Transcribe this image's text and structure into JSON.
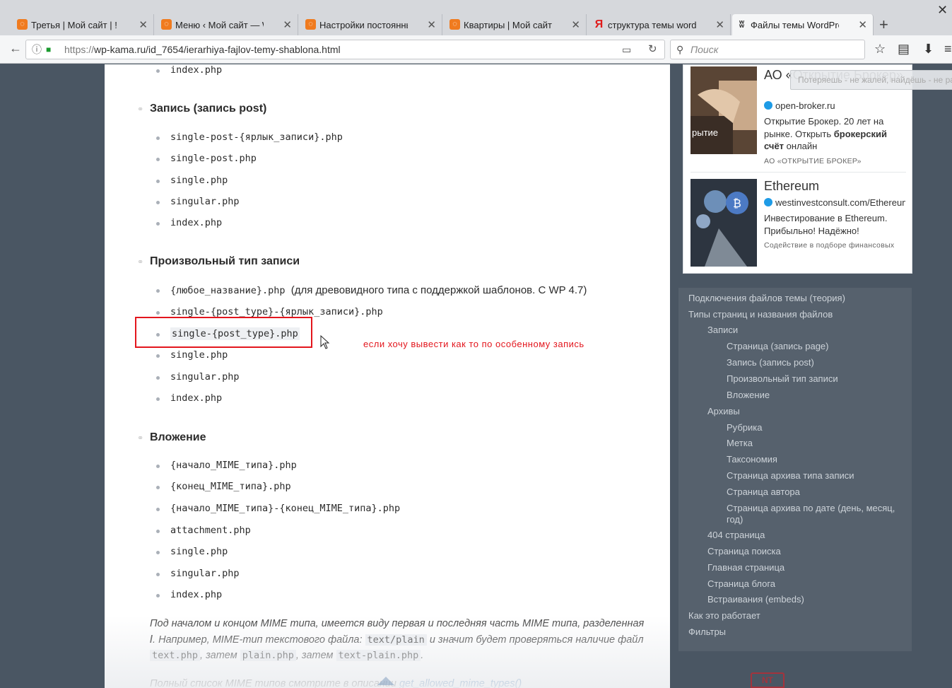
{
  "browser": {
    "tabs": [
      {
        "title": "Третья | Мой сайт | !",
        "icon": "orange-square-icon"
      },
      {
        "title": "Меню ‹ Мой сайт — WordPress",
        "icon": "orange-square-icon"
      },
      {
        "title": "Настройки постоянных ссылок",
        "icon": "orange-square-icon"
      },
      {
        "title": "Квартиры | Мой сайт | !",
        "icon": "orange-square-icon"
      },
      {
        "title": "структура темы wordpress",
        "icon": "yandex-icon"
      },
      {
        "title": "Файлы темы WordPress (шаблона)",
        "icon": "wordpress-icon"
      }
    ],
    "url_protocol": "https://",
    "url_rest": "wp-kama.ru/id_7654/ierarhiya-fajlov-temy-shablona.html",
    "search_placeholder": "Поиск"
  },
  "article": {
    "top_item": "index.php",
    "sections": [
      {
        "heading": "Запись (запись post)",
        "items": [
          "single-post-{ярлык_записи}.php",
          "single-post.php",
          "single.php",
          "singular.php",
          "index.php"
        ]
      },
      {
        "heading": "Произвольный тип записи",
        "items_first_code": "{любое_название}.php",
        "items_first_note": "(для древовидного типа с поддержкой шаблонов. С WP 4.7)",
        "items": [
          "single-{post_type}-{ярлык_записи}.php",
          "single-{post_type}.php",
          "single.php",
          "singular.php",
          "index.php"
        ]
      },
      {
        "heading": "Вложение",
        "items": [
          "{начало_MIME_типа}.php",
          "{конец_MIME_типа}.php",
          "{начало_MIME_типа}-{конец_MIME_типа}.php",
          "attachment.php",
          "single.php",
          "singular.php",
          "index.php"
        ]
      }
    ],
    "annotation": "если хочу вывести как то по особенному запись",
    "paragraph": {
      "p1": "Под началом и концом MIME типа, имеется виду первая и последняя часть MIME типа, разделенная ",
      "slash": "/",
      "p2": ". Например, MIME-тип текстового файла: ",
      "code1": "text/plain",
      "p3": " и значит будет проверяться наличие файл ",
      "code2": "text.php",
      "p4": ", затем ",
      "code3": "plain.php",
      "p5": ", затем ",
      "code4": "text-plain.php",
      "p6": "."
    },
    "paragraph2_text": "Полный список MIME типов смотрите в описании ",
    "paragraph2_link": "get_allowed_mime_types()"
  },
  "ads": [
    {
      "title": "АО «Открытие Брокер»",
      "domain": "open-broker.ru",
      "text_before": "Открытие Брокер. 20 лет на рынке. Открыть ",
      "text_bold": "брокерский счёт",
      "text_after": " онлайн",
      "source": "АО «ОТКРЫТИЕ БРОКЕР»",
      "img_caption": "рытие"
    },
    {
      "title": "Ethereum",
      "domain": "westinvestconsult.com/Ethereum",
      "text": "Инвестирование в Ethereum. Прибыльно! Надёжно!",
      "source": "Содействие в подборе финансовых"
    }
  ],
  "tooltip": "Потеряешь - не жалей, найдёшь - не радуйся",
  "toc": [
    {
      "label": "Подключения файлов темы (теория)",
      "level": 0
    },
    {
      "label": "Типы страниц и названия файлов",
      "level": 0
    },
    {
      "label": "Записи",
      "level": 1
    },
    {
      "label": "Страница (запись page)",
      "level": 2
    },
    {
      "label": "Запись (запись post)",
      "level": 2
    },
    {
      "label": "Произвольный тип записи",
      "level": 2
    },
    {
      "label": "Вложение",
      "level": 2
    },
    {
      "label": "Архивы",
      "level": 1
    },
    {
      "label": "Рубрика",
      "level": 2
    },
    {
      "label": "Метка",
      "level": 2
    },
    {
      "label": "Таксономия",
      "level": 2
    },
    {
      "label": "Страница архива типа записи",
      "level": 2
    },
    {
      "label": "Страница автора",
      "level": 2
    },
    {
      "label": "Страница архива по дате (день, месяц, год)",
      "level": 2
    },
    {
      "label": "404 страница",
      "level": 1
    },
    {
      "label": "Страница поиска",
      "level": 1
    },
    {
      "label": "Главная страница",
      "level": 1
    },
    {
      "label": "Страница блога",
      "level": 1
    },
    {
      "label": "Встраивания (embeds)",
      "level": 1
    },
    {
      "label": "Как это работает",
      "level": 0
    },
    {
      "label": "Фильтры",
      "level": 0
    }
  ],
  "logo_text": "NT",
  "colors": {
    "annotation": "#e3161d",
    "link": "#2e6aa8",
    "toc_text": "#cdd3d9",
    "sidebar_bg": "#4a5663"
  }
}
